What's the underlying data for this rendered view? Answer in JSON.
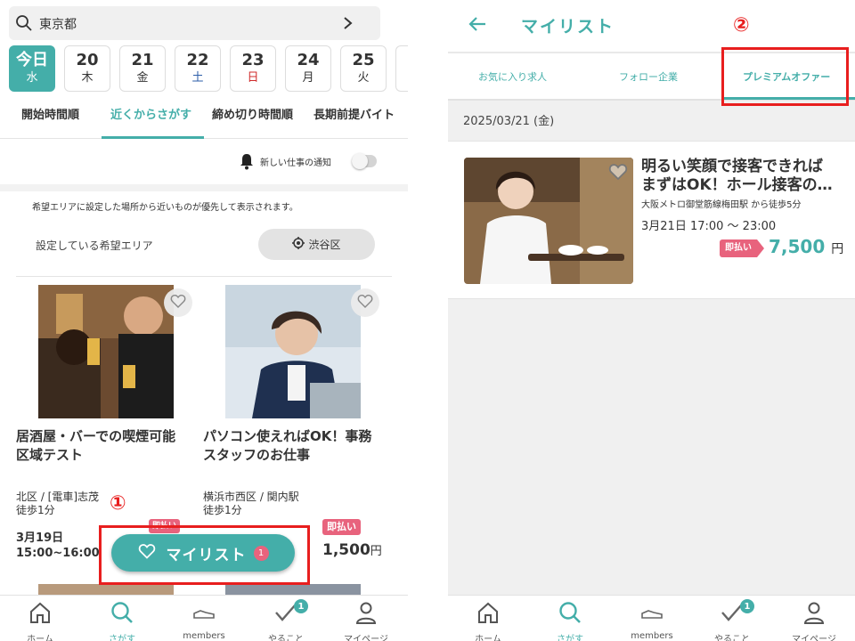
{
  "left": {
    "search": {
      "location": "東京都"
    },
    "dates": [
      {
        "day": "今日",
        "weekday": "水",
        "active": true,
        "kind": ""
      },
      {
        "day": "20",
        "weekday": "木",
        "active": false,
        "kind": ""
      },
      {
        "day": "21",
        "weekday": "金",
        "active": false,
        "kind": ""
      },
      {
        "day": "22",
        "weekday": "土",
        "active": false,
        "kind": "sat"
      },
      {
        "day": "23",
        "weekday": "日",
        "active": false,
        "kind": "sun"
      },
      {
        "day": "24",
        "weekday": "月",
        "active": false,
        "kind": ""
      },
      {
        "day": "25",
        "weekday": "火",
        "active": false,
        "kind": ""
      }
    ],
    "sort_tabs": [
      "開始時間順",
      "近くからさがす",
      "締め切り時間順",
      "長期前提バイト"
    ],
    "notify_label": "新しい仕事の通知",
    "area_note": "希望エリアに設定した場所から近いものが優先して表示されます。",
    "area_label": "設定している希望エリア",
    "area_value": "渋谷区",
    "jobs": [
      {
        "title_line1": "居酒屋・バーでの喫煙可能",
        "title_line2": "区域テスト",
        "loc_line1": "北区 / [電車]志茂",
        "loc_line2": "徒歩1分",
        "date_line1": "3月19日",
        "date_line2": "15:00~16:00",
        "badge": "即払い"
      },
      {
        "title_line1": "パソコン使えればOK！事務",
        "title_line2": "スタッフのお仕事",
        "loc_line1": "横浜市西区 / 関内駅",
        "loc_line2": "徒歩1分",
        "badge": "即払い",
        "price": "1,500",
        "price_unit": "円"
      }
    ],
    "mylist_button": {
      "label": "マイリスト",
      "count": "1"
    },
    "annotation": "①"
  },
  "right": {
    "title": "マイリスト",
    "tabs": [
      "お気に入り求人",
      "フォロー企業",
      "プレミアムオファー"
    ],
    "date_header": "2025/03/21 (金)",
    "job": {
      "title_line1": "明るい笑顔で接客できれば",
      "title_line2": "まずはOK！ホール接客の…",
      "station": "大阪メトロ御堂筋線梅田駅 から徒歩5分",
      "time": "3月21日 17:00 〜 23:00",
      "badge": "即払い",
      "price": "7,500",
      "price_unit": "円"
    },
    "annotation": "②"
  },
  "nav": {
    "items": [
      "ホーム",
      "さがす",
      "members",
      "やること",
      "マイページ"
    ],
    "todo_badge": "1"
  },
  "colors": {
    "accent": "#44aea9",
    "badge": "#e8637d",
    "highlight": "#e81e1e"
  }
}
